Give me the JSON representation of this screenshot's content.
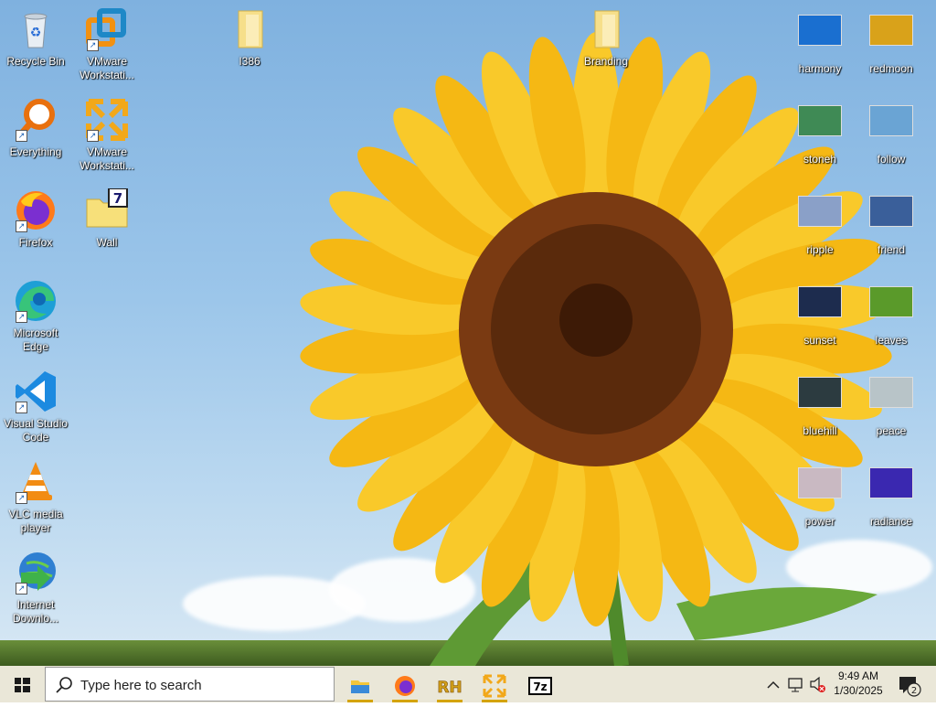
{
  "desktop_left": [
    {
      "label": "Recycle Bin",
      "icon": "recycle-bin-icon"
    },
    {
      "label": "VMware Workstati...",
      "icon": "vmware-icon"
    },
    {
      "label": "Everything",
      "icon": "everything-search-icon"
    },
    {
      "label": "VMware Workstati...",
      "icon": "vmware-player-icon"
    },
    {
      "label": "Firefox",
      "icon": "firefox-icon"
    },
    {
      "label": "Wall",
      "icon": "folder-wall-icon"
    },
    {
      "label": "Microsoft Edge",
      "icon": "edge-icon"
    },
    {
      "label": "Visual Studio Code",
      "icon": "vscode-icon"
    },
    {
      "label": "VLC media player",
      "icon": "vlc-icon"
    },
    {
      "label": "Internet Downlo...",
      "icon": "idm-icon"
    }
  ],
  "desktop_folders": [
    {
      "label": "I386",
      "icon": "folder-icon"
    },
    {
      "label": "Branding",
      "icon": "folder-icon"
    }
  ],
  "desktop_right": [
    {
      "label": "harmony",
      "color": "#1a6fd0"
    },
    {
      "label": "redmoon",
      "color": "#d9a21a"
    },
    {
      "label": "stoneh",
      "color": "#3f8a55"
    },
    {
      "label": "follow",
      "color": "#6aa4d4"
    },
    {
      "label": "ripple",
      "color": "#8aa0c8"
    },
    {
      "label": "friend",
      "color": "#3a5f9a"
    },
    {
      "label": "sunset",
      "color": "#1d2c4e"
    },
    {
      "label": "leaves",
      "color": "#5a9a2a"
    },
    {
      "label": "bluehill",
      "color": "#2c3b40"
    },
    {
      "label": "peace",
      "color": "#b8c4c8"
    },
    {
      "label": "power",
      "color": "#c9b9c2"
    },
    {
      "label": "radiance",
      "color": "#3a28b0"
    }
  ],
  "taskbar": {
    "search_placeholder": "Type here to search",
    "pinned": [
      "file-explorer-icon",
      "firefox-icon",
      "rh-app-icon",
      "vmware-icon",
      "7zip-icon"
    ],
    "seven_zip_label": "7z",
    "rh_label": "RH",
    "clock_time": "9:49 AM",
    "clock_date": "1/30/2025",
    "notification_count": "2"
  }
}
